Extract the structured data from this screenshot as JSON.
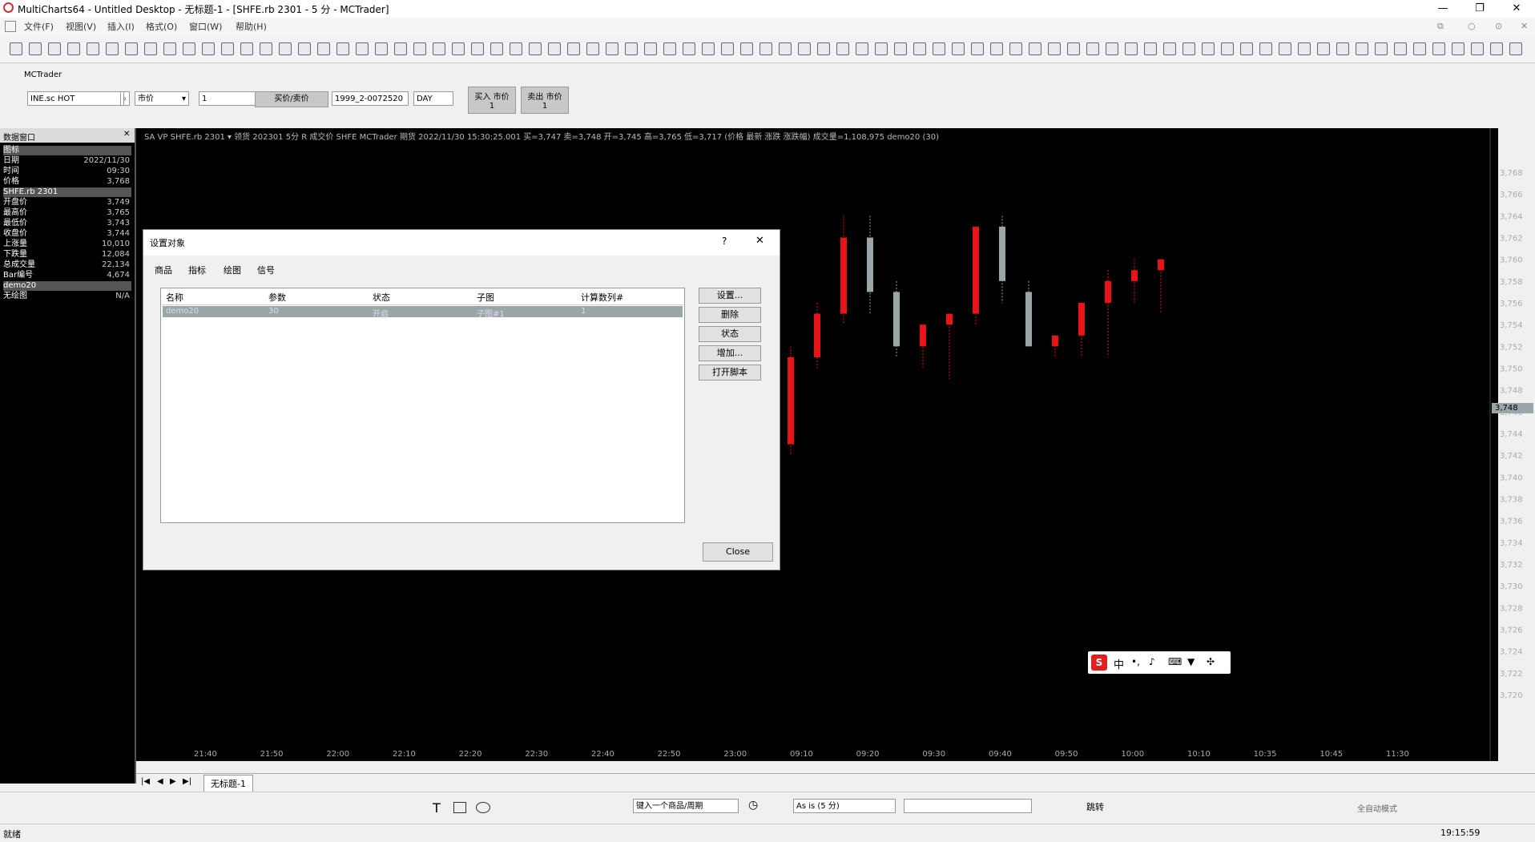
{
  "window": {
    "title": "MultiCharts64 - Untitled Desktop - 无标题-1 - [SHFE.rb 2301 - 5 分 - MCTrader]"
  },
  "menu": [
    "文件(F)",
    "视图(V)",
    "插入(I)",
    "格式(O)",
    "窗口(W)",
    "帮助(H)"
  ],
  "trade_panel": {
    "title": "MCTrader",
    "symbol": "INE.sc HOT",
    "order_type": "市价",
    "quantity": "1",
    "price_mode": "买价/卖价",
    "account": "1999_2-0072520",
    "tif": "DAY",
    "buy_button": {
      "label": "买入 市价",
      "qty": "1"
    },
    "sell_button": {
      "label": "卖出 市价",
      "qty": "1"
    }
  },
  "data_window": {
    "title": "数据窗口",
    "rows": [
      {
        "label": "图标",
        "value": ""
      },
      {
        "label": "日期",
        "value": "2022/11/30"
      },
      {
        "label": "时间",
        "value": "09:30"
      },
      {
        "label": "价格",
        "value": "3,768"
      },
      {
        "label": "SHFE.rb 2301",
        "value": ""
      },
      {
        "label": "开盘价",
        "value": "3,749"
      },
      {
        "label": "最高价",
        "value": "3,765"
      },
      {
        "label": "最低价",
        "value": "3,743"
      },
      {
        "label": "收盘价",
        "value": "3,744"
      },
      {
        "label": "上涨量",
        "value": "10,010"
      },
      {
        "label": "下跌量",
        "value": "12,084"
      },
      {
        "label": "总成交量",
        "value": "22,134"
      },
      {
        "label": "Bar编号",
        "value": "4,674"
      },
      {
        "label": "demo20",
        "value": ""
      },
      {
        "label": "无绘图",
        "value": "N/A"
      }
    ]
  },
  "chart_header": "SA VP SHFE.rb 2301 ▾ 领货 202301 5分 R 成交价 SHFE MCTrader 期货 2022/11/30 15:30:25.001 买=3,747 卖=3,748 开=3,745 高=3,765 低=3,717 (价格 最新 涨跌 涨跌幅) 成交量=1,108,975 demo20 (30)",
  "price_axis": [
    "3,768",
    "3,766",
    "3,764",
    "3,762",
    "3,760",
    "3,758",
    "3,756",
    "3,754",
    "3,752",
    "3,750",
    "3,748",
    "3,746",
    "3,744",
    "3,742",
    "3,740",
    "3,738",
    "3,736",
    "3,734",
    "3,732",
    "3,730",
    "3,728",
    "3,726",
    "3,724",
    "3,722",
    "3,720"
  ],
  "current_price_tag": "3,748",
  "time_axis": [
    "21:40",
    "21:50",
    "22:00",
    "22:10",
    "22:20",
    "22:30",
    "22:40",
    "22:50",
    "23:00",
    "09:10",
    "09:20",
    "09:30",
    "09:40",
    "09:50",
    "10:00",
    "10:10",
    "10:35",
    "10:45",
    "11:30"
  ],
  "dialog": {
    "title": "设置对象",
    "help": "?",
    "close_x": "✕",
    "tabs": [
      "商品",
      "指标",
      "绘图",
      "信号"
    ],
    "columns": [
      "名称",
      "参数",
      "状态",
      "子图",
      "计算数列#"
    ],
    "row": [
      "demo20",
      "30",
      "开启",
      "子图#1",
      "1"
    ],
    "buttons": [
      "设置...",
      "删除",
      "状态",
      "增加...",
      "打开脚本"
    ],
    "close_label": "Close"
  },
  "sheet_tab": "无标题-1",
  "bottom_toolbar": {
    "symbol_placeholder": "键入一个商品/周期",
    "resolution": "As is (5 分)",
    "jump": "跳转",
    "mode": "全自动模式"
  },
  "status": {
    "left": "就绪",
    "clock": "19:15:59"
  },
  "ime": {
    "label": "中"
  },
  "colors": {
    "up": "#e8141a",
    "down": "#9aa6a8",
    "background": "#000000"
  }
}
